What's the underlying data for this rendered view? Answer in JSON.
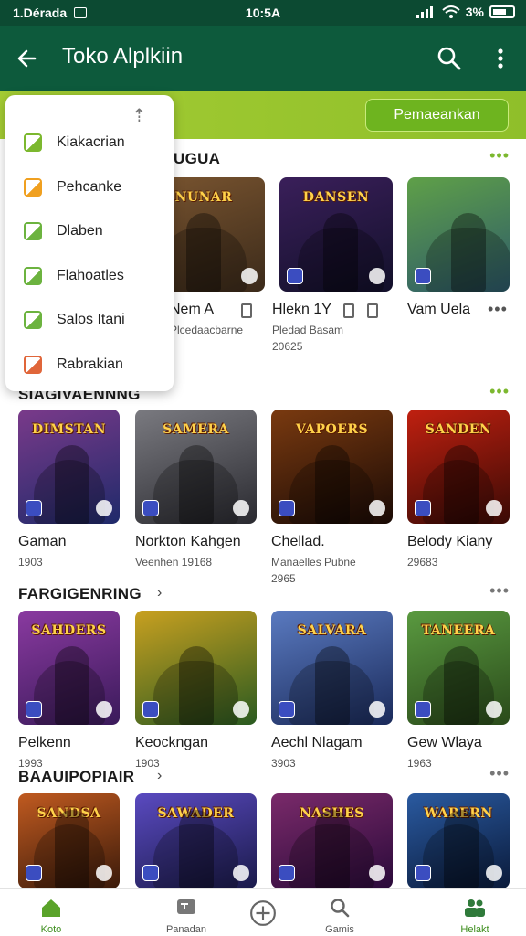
{
  "status_bar": {
    "carrier": "1.Dérada",
    "time": "10:5A",
    "battery": "3%"
  },
  "app_bar": {
    "title": "Toko Alplkiin"
  },
  "filter_strip": {
    "button_label": "Pemaeankan"
  },
  "menu": {
    "items": [
      {
        "label": "Kiakacrian",
        "icon": "chart-icon",
        "color": "#7cb82f"
      },
      {
        "label": "Pehcanke",
        "icon": "edit-icon",
        "color": "#f0a020"
      },
      {
        "label": "Dlaben",
        "icon": "check-icon",
        "color": "#6cb33f"
      },
      {
        "label": "Flahoatles",
        "icon": "refresh-icon",
        "color": "#6cb33f"
      },
      {
        "label": "Salos Itani",
        "icon": "search-badge-icon",
        "color": "#6cb33f"
      },
      {
        "label": "Rabrakian",
        "icon": "box-icon",
        "color": "#e0663a"
      }
    ]
  },
  "sections": [
    {
      "title": "UGUA",
      "cards": [
        {
          "name": "Nem A",
          "sub": "Plcedaacbarne",
          "sub2": "",
          "art": "NUNAR",
          "bg": "#7a5530",
          "bg2": "#3b2a1a"
        },
        {
          "name": "Hlekn 1Y",
          "sub": "Pledad Basam",
          "sub2": "20625",
          "art": "DANSEN",
          "bg": "#3a1f5a",
          "bg2": "#12102a"
        },
        {
          "name": "Vam Uela",
          "sub": "",
          "sub2": "",
          "art": "",
          "bg": "#5fa048",
          "bg2": "#2d5a6a"
        }
      ]
    },
    {
      "title": "SIAGIVAENNNG",
      "cards": [
        {
          "name": "Gaman",
          "sub": "1903",
          "sub2": "",
          "art": "DIMSTAN",
          "bg": "#7a3a8a",
          "bg2": "#1f2a6a"
        },
        {
          "name": "Norkton Kahgen",
          "sub": "Veenhen 19168",
          "sub2": "",
          "art": "SAMERA",
          "bg": "#7a7a80",
          "bg2": "#2a2a30"
        },
        {
          "name": "Chellad.",
          "sub": "Manaelles Pubne",
          "sub2": "2965",
          "art": "VAPOERS",
          "bg": "#7a3a10",
          "bg2": "#1a0a05"
        },
        {
          "name": "Belody Kiany",
          "sub": "29683",
          "sub2": "",
          "art": "SANDEN",
          "bg": "#c02010",
          "bg2": "#3a0a05"
        }
      ]
    },
    {
      "title": "FARGIGENRING",
      "cards": [
        {
          "name": "Pelkenn",
          "sub": "1993",
          "sub2": "",
          "art": "SAHDERS",
          "bg": "#8a3aa0",
          "bg2": "#3a1a5a"
        },
        {
          "name": "Keockngan",
          "sub": "1903",
          "sub2": "",
          "art": "",
          "bg": "#c8a020",
          "bg2": "#2a5a20"
        },
        {
          "name": "Aechl Nlagam",
          "sub": "3903",
          "sub2": "",
          "art": "SALVARA",
          "bg": "#5a7ac0",
          "bg2": "#1a2a5a"
        },
        {
          "name": "Gew Wlaya",
          "sub": "1963",
          "sub2": "",
          "art": "TANEERA",
          "bg": "#5a9a40",
          "bg2": "#2a4a1a"
        }
      ]
    },
    {
      "title": "BAAUIPOPIAIR",
      "cards": [
        {
          "name": "",
          "sub": "",
          "sub2": "",
          "art": "SANDSA",
          "bg": "#c05a20",
          "bg2": "#3a1a0a"
        },
        {
          "name": "",
          "sub": "",
          "sub2": "",
          "art": "SAWADER",
          "bg": "#5a4ac0",
          "bg2": "#1a1a4a"
        },
        {
          "name": "",
          "sub": "",
          "sub2": "",
          "art": "NASHES",
          "bg": "#7a2a6a",
          "bg2": "#2a0a3a"
        },
        {
          "name": "",
          "sub": "",
          "sub2": "",
          "art": "WARERN",
          "bg": "#2a5aa0",
          "bg2": "#0a1a3a"
        }
      ]
    }
  ],
  "bottom_nav": {
    "items": [
      {
        "label": "Koto",
        "icon": "home-icon",
        "active": true
      },
      {
        "label": "Panadan",
        "icon": "store-icon",
        "active": false
      },
      {
        "label": "",
        "icon": "add-circle-icon",
        "active": false
      },
      {
        "label": "Gamis",
        "icon": "search-icon",
        "active": false
      },
      {
        "label": "Helakt",
        "icon": "people-icon",
        "active": true
      }
    ]
  },
  "colors": {
    "primary_dark": "#0d5a3c",
    "accent_lime": "#8fbf2a"
  }
}
